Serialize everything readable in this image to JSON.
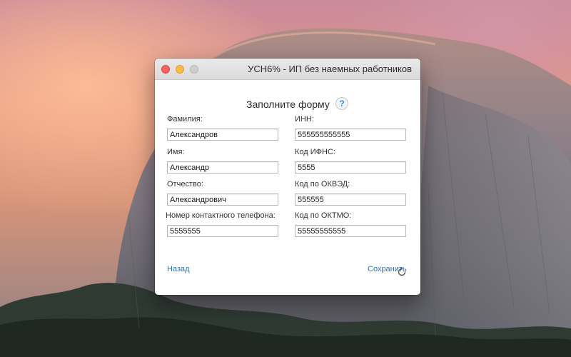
{
  "window": {
    "title": "УСН6% - ИП без наемных работников"
  },
  "form": {
    "heading": "Заполните форму",
    "help_label": "?",
    "left_fields": [
      {
        "label": "Фамилия:",
        "value": "Александров"
      },
      {
        "label": "Имя:",
        "value": "Александр"
      },
      {
        "label": "Отчество:",
        "value": "Александрович"
      },
      {
        "label": "Номер контактного телефона:",
        "value": "5555555"
      }
    ],
    "right_fields": [
      {
        "label": "ИНН:",
        "value": "555555555555"
      },
      {
        "label": "Код ИФНС:",
        "value": "5555"
      },
      {
        "label": "Код по ОКВЭД:",
        "value": "555555"
      },
      {
        "label": "Код по ОКТМО:",
        "value": "55555555555"
      }
    ]
  },
  "actions": {
    "back_label": "Назад",
    "save_label": "Сохранить",
    "refresh_icon": "refresh-icon"
  },
  "colors": {
    "link": "#2a73c4",
    "close": "#fc605c",
    "minimize": "#fdbc40",
    "zoom": "#cfcfcf"
  }
}
